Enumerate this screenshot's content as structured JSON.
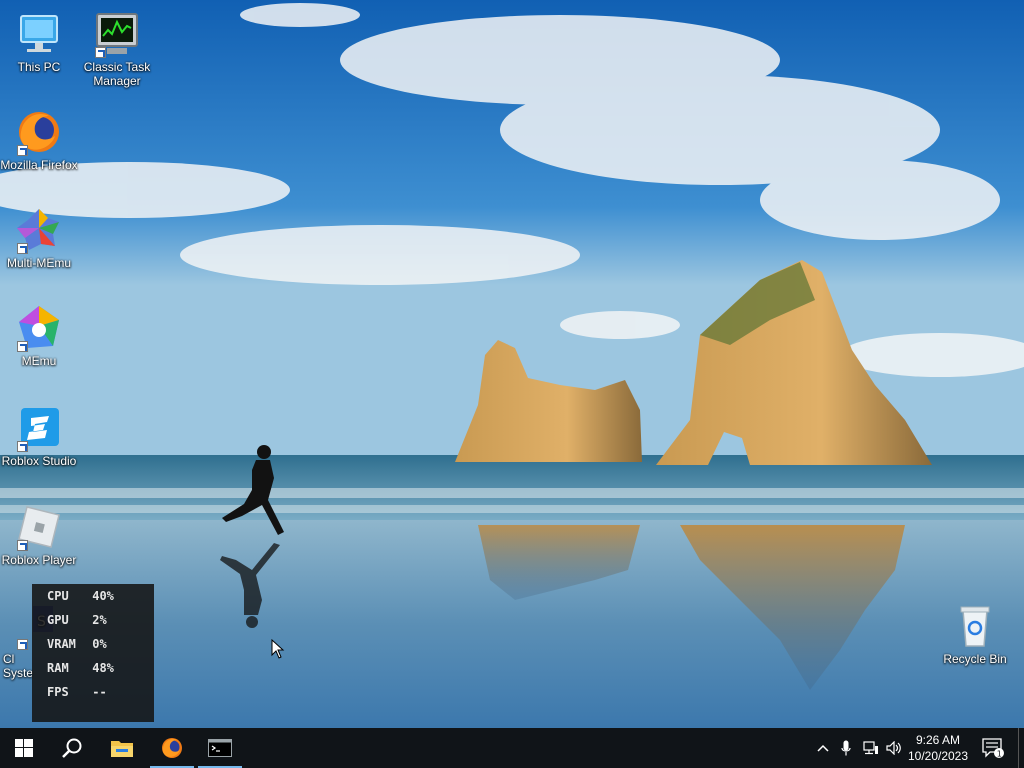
{
  "desktop": {
    "icons": [
      {
        "label": "This PC",
        "icon": "this-pc-icon"
      },
      {
        "label": "Classic Task Manager",
        "icon": "task-manager-icon"
      },
      {
        "label": "Mozilla Firefox",
        "icon": "firefox-icon"
      },
      {
        "label": "Multi-MEmu",
        "icon": "multi-memu-icon"
      },
      {
        "label": "MEmu",
        "icon": "memu-icon"
      },
      {
        "label": "Roblox Studio",
        "icon": "roblox-studio-icon"
      },
      {
        "label": "Roblox Player",
        "icon": "roblox-player-icon"
      },
      {
        "label": "Cl\nSyste",
        "icon": "system-app-icon"
      },
      {
        "label": "Recycle Bin",
        "icon": "recycle-bin-icon"
      }
    ]
  },
  "overlay": {
    "cpu_label": "CPU",
    "cpu_value": "40%",
    "gpu_label": "GPU",
    "gpu_value": "2%",
    "vram_label": "VRAM",
    "vram_value": "0%",
    "ram_label": "RAM",
    "ram_value": "48%",
    "fps_label": "FPS",
    "fps_value": "--"
  },
  "taskbar": {
    "buttons": [
      "start-icon",
      "search-icon",
      "file-explorer-icon",
      "firefox-icon",
      "terminal-icon"
    ],
    "tray_icons": [
      "chevron-up-icon",
      "microphone-icon",
      "network-icon",
      "volume-icon"
    ],
    "time": "9:26 AM",
    "date": "10/20/2023",
    "notification_count": "1"
  },
  "colors": {
    "taskbar": "#101418",
    "active_indicator": "#76b9ed",
    "sky": "#1a5e9a"
  }
}
